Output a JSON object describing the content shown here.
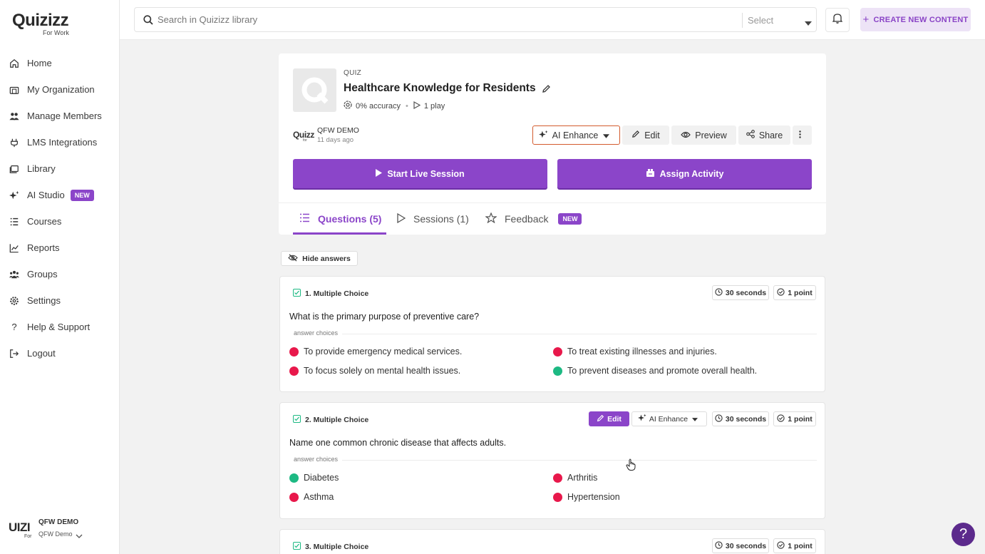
{
  "brand": {
    "logo": "Quizizz",
    "logo_sub": "For Work"
  },
  "sidebar": {
    "items": [
      {
        "label": "Home",
        "icon": "home-icon"
      },
      {
        "label": "My Organization",
        "icon": "organization-icon"
      },
      {
        "label": "Manage Members",
        "icon": "members-icon"
      },
      {
        "label": "LMS Integrations",
        "icon": "plug-icon"
      },
      {
        "label": "Library",
        "icon": "library-icon"
      },
      {
        "label": "AI Studio",
        "icon": "sparkle-icon",
        "badge": "NEW"
      },
      {
        "label": "Courses",
        "icon": "courses-icon"
      },
      {
        "label": "Reports",
        "icon": "chart-icon"
      },
      {
        "label": "Groups",
        "icon": "groups-icon"
      },
      {
        "label": "Settings",
        "icon": "gear-icon"
      },
      {
        "label": "Help & Support",
        "icon": "question-icon"
      },
      {
        "label": "Logout",
        "icon": "logout-icon"
      }
    ],
    "account": {
      "logo": "UIZI",
      "logo_sub": "For",
      "name": "QFW DEMO",
      "org": "QFW Demo"
    }
  },
  "topbar": {
    "search_placeholder": "Search in Quizizz library",
    "select_label": "Select",
    "create_label": "CREATE NEW CONTENT"
  },
  "quiz": {
    "type": "QUIZ",
    "title": "Healthcare Knowledge for Residents",
    "accuracy": "0% accuracy",
    "plays": "1 play",
    "creator_logo": "Quizz",
    "creator_logo_sub": "for",
    "creator": "QFW DEMO",
    "created": "11 days ago",
    "actions": {
      "ai_enhance": "AI Enhance",
      "edit": "Edit",
      "preview": "Preview",
      "share": "Share"
    },
    "start_label": "Start Live Session",
    "assign_label": "Assign Activity",
    "tabs": [
      {
        "label": "Questions (5)"
      },
      {
        "label": "Sessions (1)"
      },
      {
        "label": "Feedback",
        "badge": "NEW"
      }
    ]
  },
  "hide_answers_label": "Hide answers",
  "answer_choices_label": "answer choices",
  "question_actions": {
    "edit": "Edit",
    "ai_enhance": "AI Enhance"
  },
  "questions": [
    {
      "header": "1. Multiple Choice",
      "time": "30 seconds",
      "points": "1 point",
      "text": "What is the primary purpose of preventive care?",
      "choices": [
        {
          "text": "To provide emergency medical services.",
          "correct": false
        },
        {
          "text": "To treat existing illnesses and injuries.",
          "correct": false
        },
        {
          "text": "To focus solely on mental health issues.",
          "correct": false
        },
        {
          "text": "To prevent diseases and promote overall health.",
          "correct": true
        }
      ]
    },
    {
      "header": "2. Multiple Choice",
      "time": "30 seconds",
      "points": "1 point",
      "text": "Name one common chronic disease that affects adults.",
      "choices": [
        {
          "text": "Diabetes",
          "correct": true
        },
        {
          "text": "Arthritis",
          "correct": false
        },
        {
          "text": "Asthma",
          "correct": false
        },
        {
          "text": "Hypertension",
          "correct": false
        }
      ]
    },
    {
      "header": "3. Multiple Choice",
      "time": "30 seconds",
      "points": "1 point"
    }
  ],
  "colors": {
    "accent": "#8b45c9",
    "correct": "#1db983",
    "incorrect": "#e8184b",
    "ai_border": "#d35b2e"
  }
}
